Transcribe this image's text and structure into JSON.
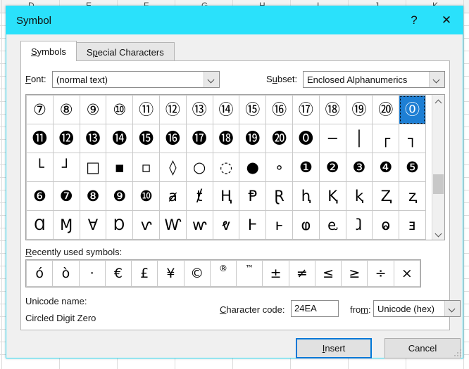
{
  "window": {
    "title": "Symbol",
    "help_label": "?",
    "close_label": "✕"
  },
  "tabs": [
    {
      "id": "symbols",
      "label": "Symbols",
      "accel": "S",
      "active": true
    },
    {
      "id": "special-characters",
      "label": "Special Characters",
      "accel": "p",
      "active": false
    }
  ],
  "font_row": {
    "font_label": "Font:",
    "font_accel": "F",
    "font_value": "(normal text)",
    "subset_label": "Subset:",
    "subset_accel": "u",
    "subset_value": "Enclosed Alphanumerics"
  },
  "grid": {
    "columns": 15,
    "rows": 5,
    "selected_index": 14,
    "selected_char": "⓪",
    "cells": [
      "⑦",
      "⑧",
      "⑨",
      "⑩",
      "⑪",
      "⑫",
      "⑬",
      "⑭",
      "⑮",
      "⑯",
      "⑰",
      "⑱",
      "⑲",
      "⑳",
      "⓪",
      "⓫",
      "⓬",
      "⓭",
      "⓮",
      "⓯",
      "⓰",
      "⓱",
      "⓲",
      "⓳",
      "⓴",
      "⓿",
      "─",
      "│",
      "┌",
      "┐",
      "└",
      "┘",
      "□",
      "▪",
      "▫",
      "◊",
      "○",
      "◌",
      "●",
      "∘",
      "❶",
      "❷",
      "❸",
      "❹",
      "❺",
      "❻",
      "❼",
      "❽",
      "❾",
      "❿",
      "ⱥ",
      "ⱦ",
      "Ⱨ",
      "Ᵽ",
      "Ɽ",
      "ⱨ",
      "Ⱪ",
      "ⱪ",
      "Ⱬ",
      "ⱬ",
      "Ɑ",
      "Ɱ",
      "Ɐ",
      "Ɒ",
      "ⱱ",
      "Ⱳ",
      "ⱳ",
      "ⱴ",
      "Ⱶ",
      "ⱶ",
      "ⱷ",
      "ⱸ",
      "ⱹ",
      "ⱺ",
      "ⱻ"
    ],
    "scrollbar": {
      "up_arrow": "⌃",
      "down_arrow": "⌄"
    }
  },
  "recent": {
    "label": "Recently used symbols:",
    "accel": "R",
    "symbols": [
      "ó",
      "ò",
      "·",
      "€",
      "£",
      "¥",
      "©",
      "®",
      "™",
      "±",
      "≠",
      "≤",
      "≥",
      "÷",
      "×"
    ]
  },
  "details": {
    "unicode_name_label": "Unicode name:",
    "unicode_name_value": "Circled Digit Zero",
    "character_code_label": "Character code:",
    "character_code_accel": "C",
    "character_code_value": "24EA",
    "from_label": "from:",
    "from_accel": "m",
    "from_value": "Unicode (hex)"
  },
  "footer": {
    "insert_label": "Insert",
    "insert_accel": "I",
    "cancel_label": "Cancel"
  },
  "background": {
    "column_headers": [
      "D",
      "E",
      "F",
      "G",
      "H",
      "I",
      "J",
      "K"
    ]
  },
  "colors": {
    "title_bar": "#2ae1fb",
    "selection": "#1e7fd4",
    "primary_button_border": "#0078d7",
    "dialog_background": "#f0f0f0"
  }
}
